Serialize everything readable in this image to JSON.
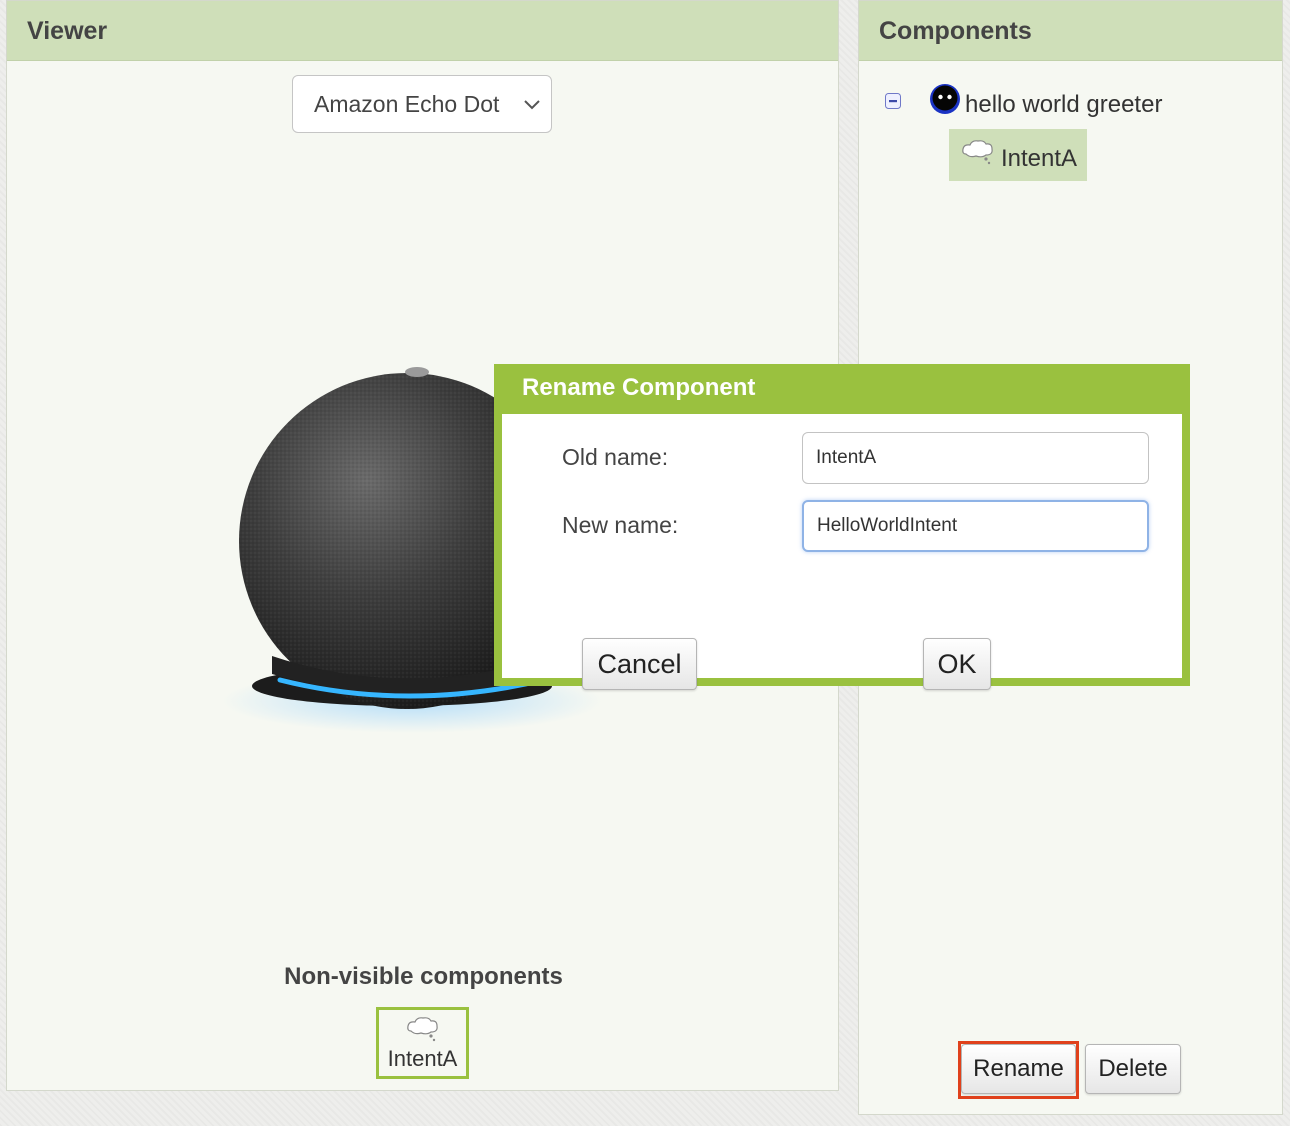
{
  "viewer": {
    "title": "Viewer",
    "device_select": {
      "selected": "Amazon Echo Dot"
    },
    "non_visible": {
      "title": "Non-visible components",
      "items": [
        {
          "label": "IntentA",
          "icon": "intent-cloud-icon"
        }
      ]
    }
  },
  "components": {
    "title": "Components",
    "tree": {
      "root": {
        "label": "hello world greeter",
        "icon": "greeter-icon",
        "toggle": "collapse-icon"
      },
      "children": [
        {
          "label": "IntentA",
          "icon": "intent-cloud-icon",
          "selected": true
        }
      ]
    },
    "buttons": {
      "rename": "Rename",
      "delete": "Delete"
    }
  },
  "dialog": {
    "title": "Rename Component",
    "old_name_label": "Old name:",
    "old_name_value": "IntentA",
    "new_name_label": "New name:",
    "new_name_value": "HelloWorldIntent",
    "cancel": "Cancel",
    "ok": "OK"
  },
  "colors": {
    "header_bg": "#cfdfb9",
    "dialog_accent": "#9ac13f",
    "rename_highlight": "#e0411c",
    "echo_ring": "#2fa8ff"
  }
}
